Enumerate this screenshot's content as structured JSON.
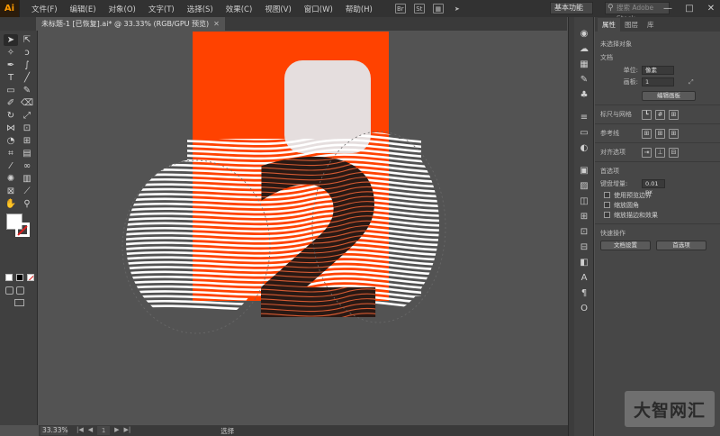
{
  "app": {
    "logo": "Ai"
  },
  "menu": [
    "文件(F)",
    "编辑(E)",
    "对象(O)",
    "文字(T)",
    "选择(S)",
    "效果(C)",
    "视图(V)",
    "窗口(W)",
    "帮助(H)"
  ],
  "menu_tools": [
    "Br",
    "St"
  ],
  "workspace": "基本功能",
  "search": {
    "placeholder": "搜索 Adobe Stock"
  },
  "window_controls": [
    "—",
    "□",
    "✕"
  ],
  "doc_tab": {
    "title": "未标题-1 [已恢复].ai* @ 33.33% (RGB/GPU 预览)",
    "close": "✕"
  },
  "status": {
    "zoom": "33.33%",
    "page": "1",
    "tool": "选择"
  },
  "panel": {
    "tabs": [
      "属性",
      "图层",
      "库"
    ],
    "no_selection": "未选择对象",
    "document": "文档",
    "units_label": "单位:",
    "units_value": "像素",
    "artboard_label": "画板:",
    "artboard_value": "1",
    "edit_artboards": "编辑画板",
    "rulers_grids": "标尺与网格",
    "guides": "参考线",
    "align": "对齐选项",
    "preferences": "首选项",
    "keyboard_increment_label": "键盘增量:",
    "keyboard_increment_value": "0.01 px",
    "use_preview_bounds": "使用预览边界",
    "scale_corners": "缩放圆角",
    "scale_strokes": "缩放描边和效果",
    "quick_actions": "快速操作",
    "document_setup": "文档设置",
    "preferences_btn": "首选项"
  },
  "canvas_art": {
    "artboard_color": "#ff4200",
    "rounded_rect_color": "#e5dede",
    "numeral_color": "#2a1914",
    "numeral": "2"
  },
  "watermark": "大智网汇"
}
